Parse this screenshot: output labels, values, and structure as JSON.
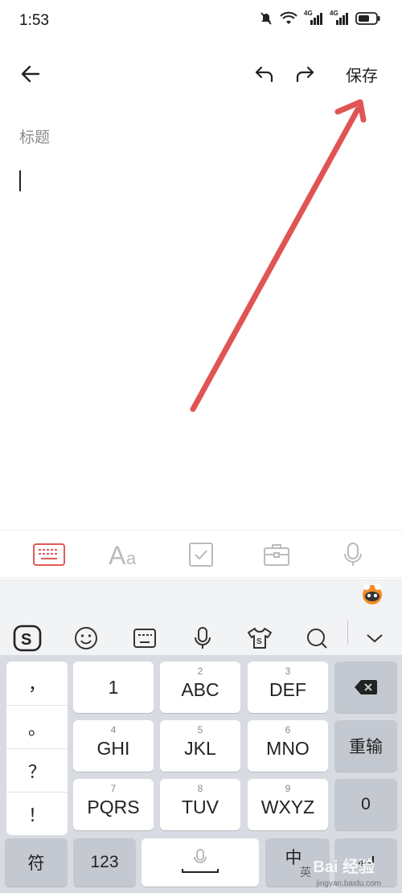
{
  "status_bar": {
    "time": "1:53",
    "signal1": "4G",
    "signal2": "4G"
  },
  "nav": {
    "save_label": "保存"
  },
  "editor": {
    "title_placeholder": "标题"
  },
  "keyboard": {
    "punctuation": [
      "，",
      "。",
      "？",
      "！"
    ],
    "rows": [
      [
        {
          "num": "",
          "label": "1"
        },
        {
          "num": "2",
          "label": "ABC"
        },
        {
          "num": "3",
          "label": "DEF"
        }
      ],
      [
        {
          "num": "4",
          "label": "GHI"
        },
        {
          "num": "5",
          "label": "JKL"
        },
        {
          "num": "6",
          "label": "MNO"
        }
      ],
      [
        {
          "num": "7",
          "label": "PQRS"
        },
        {
          "num": "8",
          "label": "TUV"
        },
        {
          "num": "9",
          "label": "WXYZ"
        }
      ]
    ],
    "reenter_label": "重输",
    "zero_label": "0",
    "symbols_label": "符",
    "numbers_label": "123",
    "chinese_label": "中",
    "chinese_sub": "英"
  },
  "watermark": {
    "brand": "Bai 经验",
    "url": "jingyan.baidu.com"
  },
  "colors": {
    "annotation_arrow": "#e15454",
    "active_tool": "#e05a5a",
    "keyboard_bg": "#d8dbe1",
    "dark_key": "#c4c8d0"
  }
}
